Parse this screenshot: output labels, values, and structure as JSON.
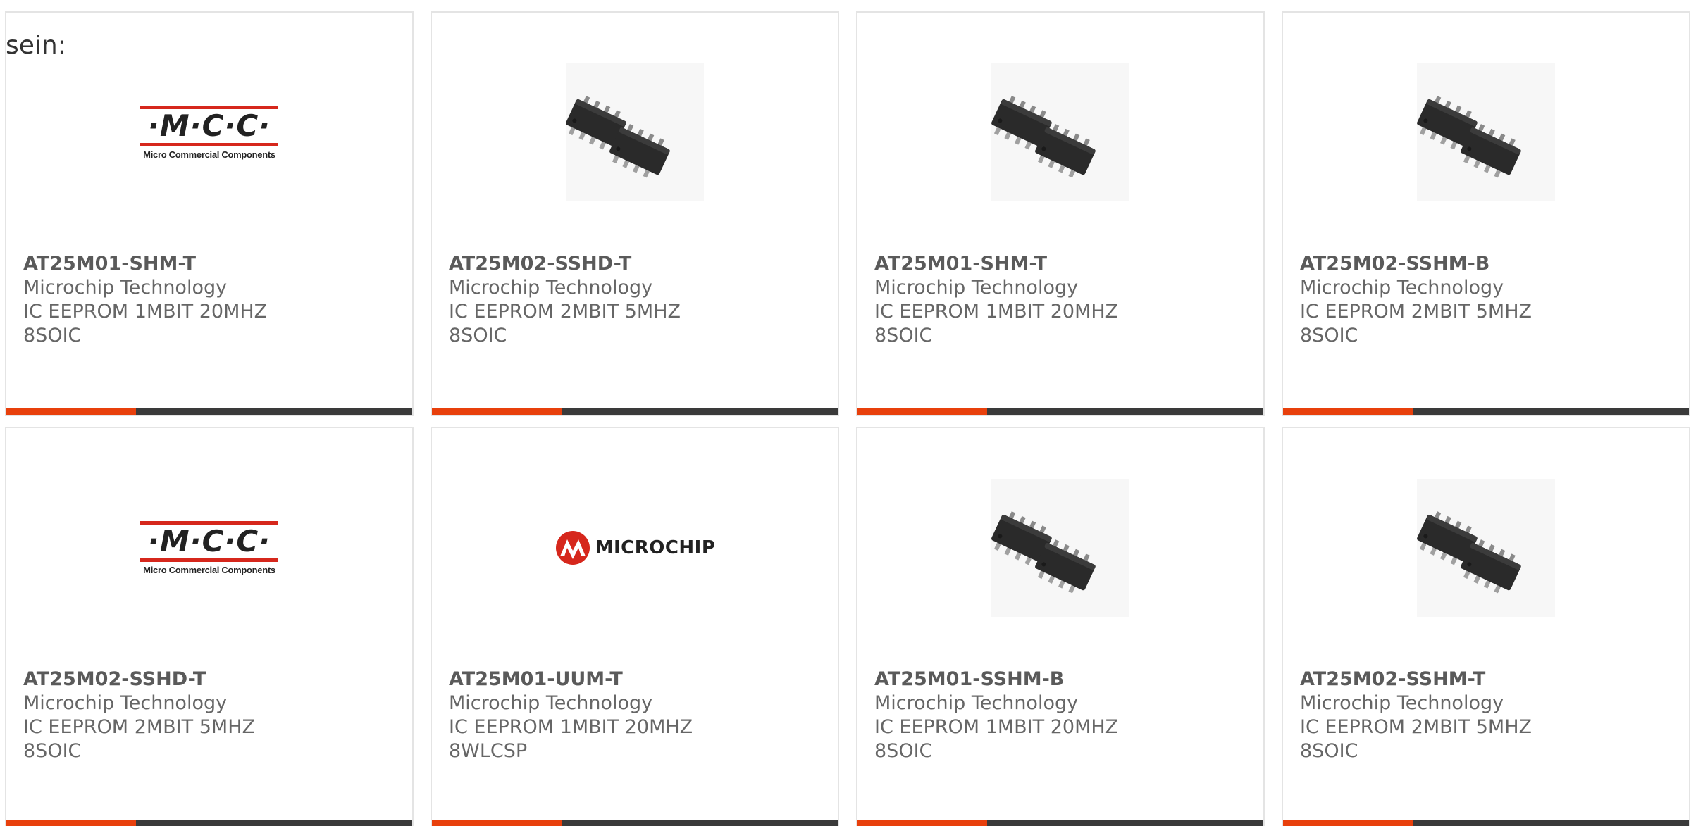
{
  "intro_text": "sein:",
  "accent_color": "#e8400c",
  "bar_color": "#3a3a3a",
  "logos": {
    "mcc_letters": "·M·C·C·",
    "mcc_sub": "Micro Commercial Components",
    "microchip_name": "MICROCHIP"
  },
  "products": [
    {
      "part": "AT25M01-SHM-T",
      "manufacturer": "Microchip Technology",
      "description": "IC EEPROM 1MBIT 20MHZ 8SOIC",
      "image": "mcc-logo"
    },
    {
      "part": "AT25M02-SSHD-T",
      "manufacturer": "Microchip Technology",
      "description": "IC EEPROM 2MBIT 5MHZ 8SOIC",
      "image": "soic-chip"
    },
    {
      "part": "AT25M01-SHM-T",
      "manufacturer": "Microchip Technology",
      "description": "IC EEPROM 1MBIT 20MHZ 8SOIC",
      "image": "soic-chip"
    },
    {
      "part": "AT25M02-SSHM-B",
      "manufacturer": "Microchip Technology",
      "description": "IC EEPROM 2MBIT 5MHZ 8SOIC",
      "image": "soic-chip"
    },
    {
      "part": "AT25M02-SSHD-T",
      "manufacturer": "Microchip Technology",
      "description": "IC EEPROM 2MBIT 5MHZ 8SOIC",
      "image": "mcc-logo"
    },
    {
      "part": "AT25M01-UUM-T",
      "manufacturer": "Microchip Technology",
      "description": "IC EEPROM 1MBIT 20MHZ 8WLCSP",
      "image": "microchip-logo"
    },
    {
      "part": "AT25M01-SSHM-B",
      "manufacturer": "Microchip Technology",
      "description": "IC EEPROM 1MBIT 20MHZ 8SOIC",
      "image": "soic-chip"
    },
    {
      "part": "AT25M02-SSHM-T",
      "manufacturer": "Microchip Technology",
      "description": "IC EEPROM 2MBIT 5MHZ 8SOIC",
      "image": "soic-chip"
    }
  ]
}
